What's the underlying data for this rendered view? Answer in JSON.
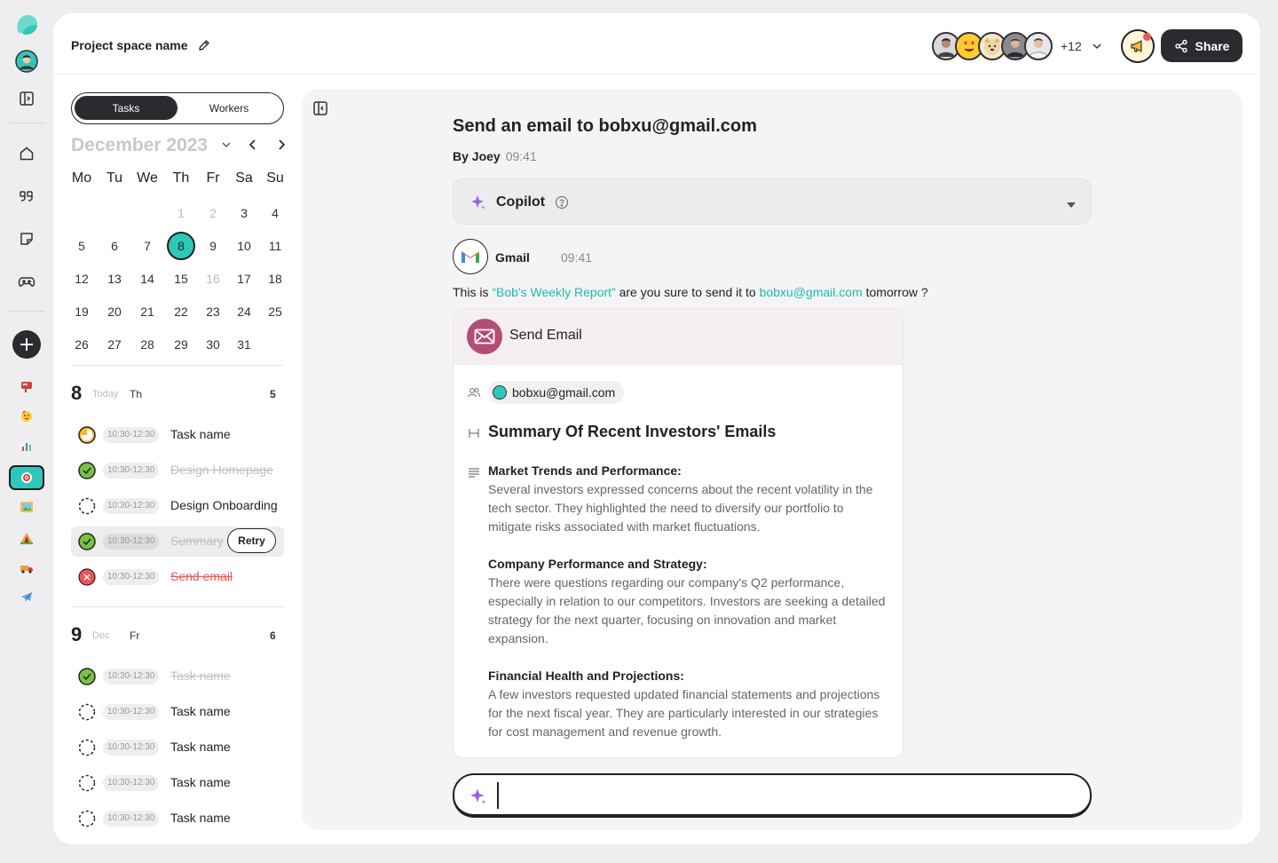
{
  "topbar": {
    "project_name": "Project space name",
    "members_more": "+12",
    "share_label": "Share"
  },
  "tabs": {
    "tasks": "Tasks",
    "workers": "Workers"
  },
  "calendar": {
    "month_title": "December 2023",
    "weekdays": [
      "Mo",
      "Tu",
      "We",
      "Th",
      "Fr",
      "Sa",
      "Su"
    ],
    "rows": [
      [
        "",
        "",
        "",
        "1",
        "2",
        "3",
        "4"
      ],
      [
        "5",
        "6",
        "7",
        "8",
        "9",
        "10",
        "11"
      ],
      [
        "12",
        "13",
        "14",
        "15",
        "16",
        "17",
        "18"
      ],
      [
        "19",
        "20",
        "21",
        "22",
        "23",
        "24",
        "25"
      ],
      [
        "26",
        "27",
        "28",
        "29",
        "30",
        "31",
        ""
      ]
    ],
    "selected_day": "8"
  },
  "day_groups": [
    {
      "num": "8",
      "sub": "Today",
      "dow": "Th",
      "count": "5",
      "tasks": [
        {
          "time": "10:30-12:30",
          "name": "Task name",
          "status": "progress"
        },
        {
          "time": "10:30-12:30",
          "name": "Design Homepage",
          "status": "done"
        },
        {
          "time": "10:30-12:30",
          "name": "Design Onboarding",
          "status": "todo"
        },
        {
          "time": "10:30-12:30",
          "name": "Summary",
          "status": "done",
          "action": "Retry"
        },
        {
          "time": "10:30-12:30",
          "name": "Send email",
          "status": "failed"
        }
      ]
    },
    {
      "num": "9",
      "sub": "Dec",
      "dow": "Fr",
      "count": "6",
      "tasks": [
        {
          "time": "10:30-12:30",
          "name": "Task name",
          "status": "done"
        },
        {
          "time": "10:30-12:30",
          "name": "Task name",
          "status": "todo"
        },
        {
          "time": "10:30-12:30",
          "name": "Task name",
          "status": "todo"
        },
        {
          "time": "10:30-12:30",
          "name": "Task name",
          "status": "todo"
        },
        {
          "time": "10:30-12:30",
          "name": "Task name",
          "status": "todo"
        }
      ]
    }
  ],
  "message": {
    "title": "Send an email to bobxu@gmail.com",
    "by": "By Joey",
    "time": "09:41",
    "copilot_label": "Copilot",
    "sender_name": "Gmail",
    "sender_time": "09:41",
    "text_prefix": "This is ",
    "text_report": "“Bob's Weekly Report”",
    "text_mid": " are you sure to send it to ",
    "text_email": "bobxu@gmail.com",
    "text_suffix": " tomorrow ?"
  },
  "email_card": {
    "header": "Send Email",
    "recipient": "bobxu@gmail.com",
    "subject": "Summary Of Recent Investors' Emails",
    "sections": [
      {
        "title": "Market Trends and Performance:",
        "text": "Several investors expressed concerns about the recent volatility in the tech sector. They highlighted the need to diversify our portfolio to mitigate risks associated with market fluctuations."
      },
      {
        "title": "Company Performance and Strategy:",
        "text": "There were questions regarding our company's Q2 performance, especially in relation to our competitors. Investors are seeking a detailed strategy for the next quarter, focusing on innovation and market expansion."
      },
      {
        "title": "Financial Health and Projections:",
        "text": "A few investors requested updated financial statements and projections for the next fiscal year. They are particularly interested in our strategies for cost management and revenue growth."
      }
    ]
  },
  "composer": {
    "value": ""
  },
  "colors": {
    "accent": "#2ec8b8",
    "link": "#1fbba9",
    "danger": "#f05454",
    "success": "#7ac143",
    "email_icon": "#b24d78"
  }
}
